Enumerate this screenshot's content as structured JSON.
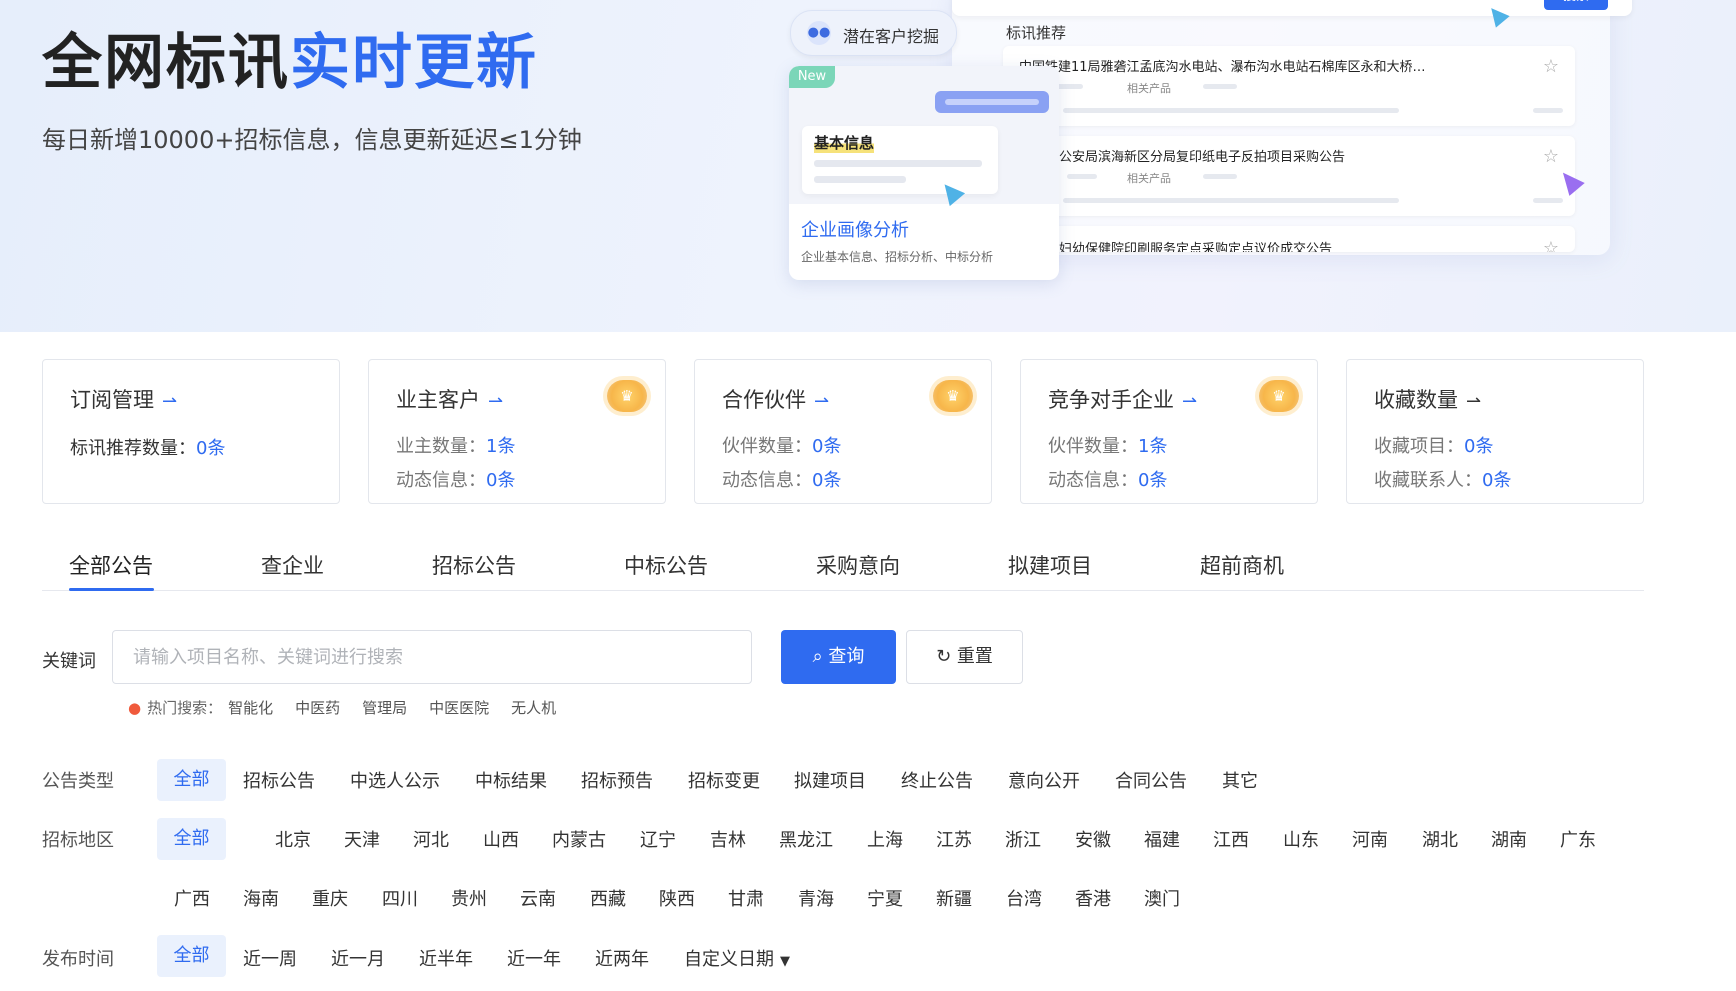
{
  "hero": {
    "title_black": "全网标讯",
    "title_blue": "实时更新",
    "subtitle": "每日新增10000+招标信息，信息更新延迟≤1分钟"
  },
  "preview": {
    "search_button": "搜索",
    "heading": "标讯推荐",
    "pill_label": "潜在客户挖掘",
    "new_tag": "New",
    "info_label": "基本信息",
    "card_title": "企业画像分析",
    "card_sub": "企业基本信息、招标分析、中标分析",
    "related_label": "相关产品",
    "items": [
      "中国铁建11局雅砻江孟底沟水电站、瀑布沟水电站石棉库区永和大桥…",
      "公安局滨海新区分局复印纸电子反拍项目采购公告",
      "妇幼保健院印刷服务定点采购定点议价成交公告"
    ]
  },
  "stats": [
    {
      "title": "订阅管理",
      "lines": [
        {
          "label": "标讯推荐数量：",
          "value": "0条"
        }
      ]
    },
    {
      "title": "业主客户",
      "lines": [
        {
          "label": "业主数量：",
          "value": "1条"
        },
        {
          "label": "动态信息：",
          "value": "0条"
        }
      ]
    },
    {
      "title": "合作伙伴",
      "lines": [
        {
          "label": "伙伴数量：",
          "value": "0条"
        },
        {
          "label": "动态信息：",
          "value": "0条"
        }
      ]
    },
    {
      "title": "竞争对手企业",
      "lines": [
        {
          "label": "伙伴数量：",
          "value": "1条"
        },
        {
          "label": "动态信息：",
          "value": "0条"
        }
      ]
    },
    {
      "title": "收藏数量",
      "lines": [
        {
          "label": "收藏项目：",
          "value": "0条"
        },
        {
          "label": "收藏联系人：",
          "value": "0条"
        }
      ]
    }
  ],
  "tabs": [
    "全部公告",
    "查企业",
    "招标公告",
    "中标公告",
    "采购意向",
    "拟建项目",
    "超前商机"
  ],
  "search": {
    "label": "关键词",
    "placeholder": "请输入项目名称、关键词进行搜索",
    "search_button": "查询",
    "reset_button": "重置",
    "hot_label": "热门搜索：",
    "hot": [
      "智能化",
      "中医药",
      "管理局",
      "中医医院",
      "无人机"
    ]
  },
  "filters": {
    "type_label": "公告类型",
    "type": [
      "全部",
      "招标公告",
      "中选人公示",
      "中标结果",
      "招标预告",
      "招标变更",
      "拟建项目",
      "终止公告",
      "意向公开",
      "合同公告",
      "其它"
    ],
    "region_label": "招标地区",
    "region_row1": [
      "全部",
      "北京",
      "天津",
      "河北",
      "山西",
      "内蒙古",
      "辽宁",
      "吉林",
      "黑龙江",
      "上海",
      "江苏",
      "浙江",
      "安徽",
      "福建",
      "江西",
      "山东",
      "河南",
      "湖北",
      "湖南",
      "广东"
    ],
    "region_row2": [
      "广西",
      "海南",
      "重庆",
      "四川",
      "贵州",
      "云南",
      "西藏",
      "陕西",
      "甘肃",
      "青海",
      "宁夏",
      "新疆",
      "台湾",
      "香港",
      "澳门"
    ],
    "time_label": "发布时间",
    "time": [
      "全部",
      "近一周",
      "近一月",
      "近半年",
      "近一年",
      "近两年",
      "自定义日期"
    ]
  },
  "colors": {
    "accent": "#2f6bf0",
    "chip_bg": "#eaf1fd"
  }
}
